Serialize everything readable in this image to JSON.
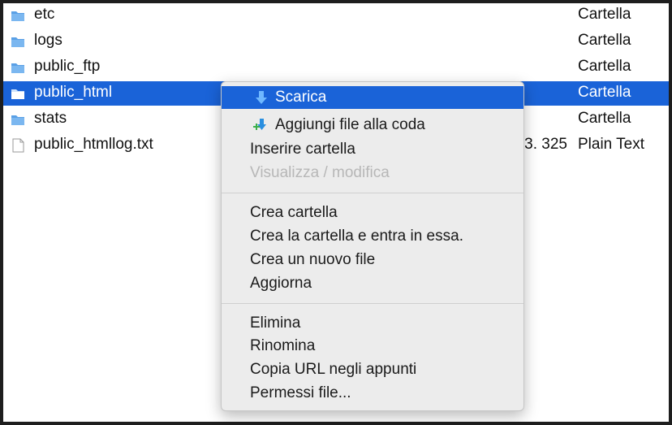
{
  "file_list": {
    "rows": [
      {
        "name": "etc",
        "size": "",
        "kind": "Cartella",
        "type": "folder"
      },
      {
        "name": "logs",
        "size": "",
        "kind": "Cartella",
        "type": "folder"
      },
      {
        "name": "public_ftp",
        "size": "",
        "kind": "Cartella",
        "type": "folder"
      },
      {
        "name": "public_html",
        "size": "",
        "kind": "Cartella",
        "type": "folder",
        "selected": true
      },
      {
        "name": "stats",
        "size": "",
        "kind": "Cartella",
        "type": "folder"
      },
      {
        "name": "public_htmllog.txt",
        "size": "3. 325",
        "kind": "Plain Text",
        "type": "file"
      }
    ]
  },
  "context_menu": {
    "items": [
      {
        "label": "Scarica",
        "icon": "download-arrow-icon",
        "highlighted": true
      },
      {
        "label": "Aggiungi file alla coda",
        "icon": "add-to-queue-icon"
      },
      {
        "label": "Inserire cartella"
      },
      {
        "label": "Visualizza / modifica",
        "disabled": true
      },
      {
        "label": "Crea cartella"
      },
      {
        "label": "Crea la cartella e entra in essa."
      },
      {
        "label": "Crea un nuovo file"
      },
      {
        "label": "Aggiorna"
      },
      {
        "label": "Elimina"
      },
      {
        "label": "Rinomina"
      },
      {
        "label": "Copia URL negli appunti"
      },
      {
        "label": "Permessi file..."
      }
    ]
  },
  "colors": {
    "selection": "#1a63d8",
    "folder_icon": "#5aa0e6",
    "menu_background": "#ececec",
    "disabled_text": "#b7b7b7"
  }
}
